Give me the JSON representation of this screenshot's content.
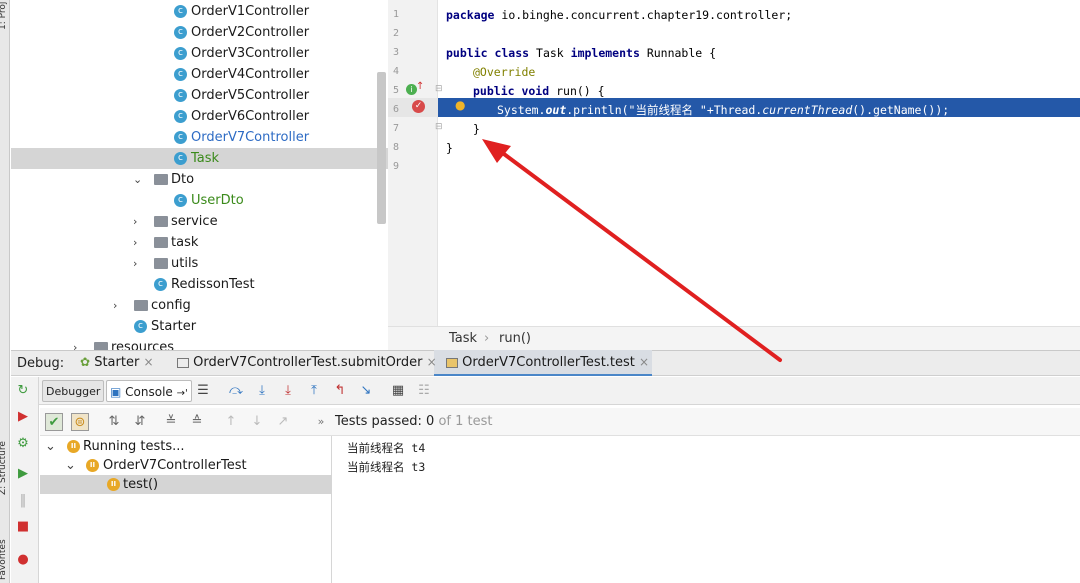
{
  "left_strip": {
    "project_label": "1: Proj",
    "structure_label": "Z: Structure",
    "favorites_label": "Favorites"
  },
  "project_tree": {
    "items": [
      {
        "label": "OrderV1Controller",
        "kind": "class"
      },
      {
        "label": "OrderV2Controller",
        "kind": "class"
      },
      {
        "label": "OrderV3Controller",
        "kind": "class"
      },
      {
        "label": "OrderV4Controller",
        "kind": "class"
      },
      {
        "label": "OrderV5Controller",
        "kind": "class"
      },
      {
        "label": "OrderV6Controller",
        "kind": "class"
      },
      {
        "label": "OrderV7Controller",
        "kind": "class",
        "color": "#2d6bc4"
      },
      {
        "label": "Task",
        "kind": "class",
        "color": "#3a8a1a",
        "selected": true
      },
      {
        "label": "Dto",
        "kind": "folder",
        "expanded": true
      },
      {
        "label": "UserDto",
        "kind": "class",
        "color": "#3a8a1a"
      },
      {
        "label": "service",
        "kind": "folder",
        "expanded": false
      },
      {
        "label": "task",
        "kind": "folder",
        "expanded": false
      },
      {
        "label": "utils",
        "kind": "folder",
        "expanded": false
      },
      {
        "label": "RedissonTest",
        "kind": "class"
      },
      {
        "label": "config",
        "kind": "folder",
        "expanded": false
      },
      {
        "label": "Starter",
        "kind": "class"
      },
      {
        "label": "resources",
        "kind": "folder",
        "expanded": false
      }
    ]
  },
  "editor": {
    "line_numbers": [
      "1",
      "2",
      "3",
      "4",
      "5",
      "6",
      "7",
      "8",
      "9"
    ],
    "lines": {
      "l1_kw": "package",
      "l1_rest": " io.binghe.concurrent.chapter19.controller;",
      "l3_kw1": "public class",
      "l3_mid": " Task ",
      "l3_kw2": "implements",
      "l3_rest": " Runnable {",
      "l4_ann": "@Override",
      "l5_kw": "public void",
      "l5_rest": " run() {",
      "l6_a": "System.",
      "l6_b": "out",
      "l6_c": ".println(\"当前线程名 \"+Thread.",
      "l6_d": "currentThread",
      "l6_e": "().getName());",
      "l7": "}",
      "l8": "}"
    },
    "breadcrumb": [
      "Task",
      "run()"
    ],
    "breadcrumb_sep": "›"
  },
  "debug": {
    "label": "Debug:",
    "tabs": [
      {
        "label": "Starter",
        "close": "×"
      },
      {
        "label": "OrderV7ControllerTest.submitOrder",
        "close": "×"
      },
      {
        "label": "OrderV7ControllerTest.test",
        "close": "×",
        "active": true
      }
    ],
    "toolbar": {
      "debugger_label": "Debugger",
      "console_label": "Console",
      "console_suffix": "→'"
    }
  },
  "runner": {
    "tests_passed_label": "Tests passed:",
    "passed_count": "0",
    "of_total": "of 1 test"
  },
  "test_tree": {
    "items": [
      {
        "label": "Running tests...",
        "depth": 0,
        "chevron": "⌄"
      },
      {
        "label": "OrderV7ControllerTest",
        "depth": 1,
        "chevron": "⌄"
      },
      {
        "label": "test()",
        "depth": 2,
        "selected": true
      }
    ]
  },
  "console": {
    "lines": [
      "当前线程名 t4",
      "当前线程名 t3"
    ]
  },
  "colors": {
    "accent": "#2458a8",
    "annotation_arrow": "#e02020",
    "class_icon": "#3c9ecf",
    "running_icon": "#e8a826"
  }
}
